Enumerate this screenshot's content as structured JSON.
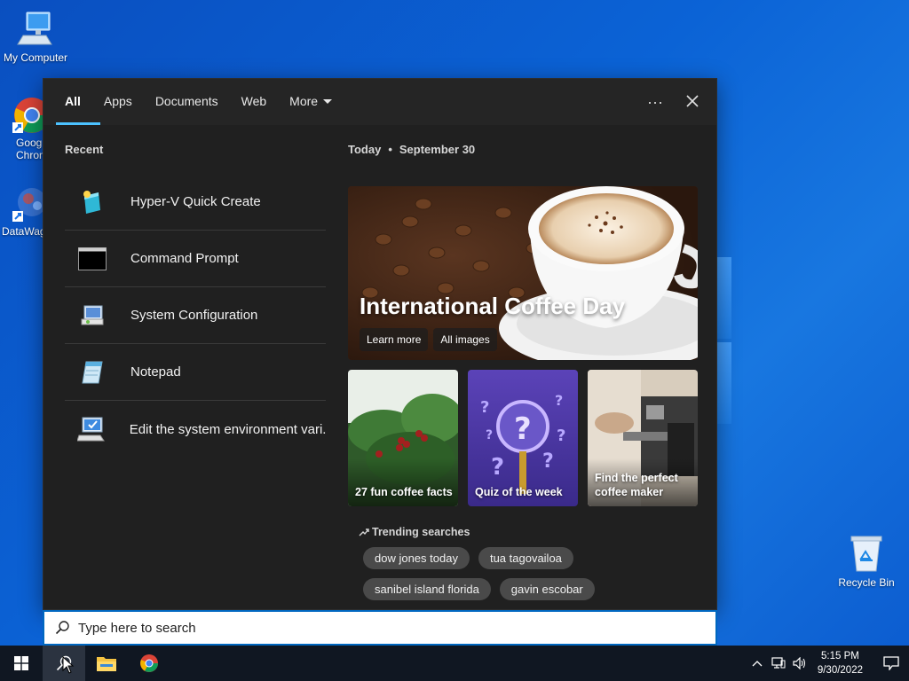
{
  "desktop": {
    "icons": [
      {
        "label": "My Computer",
        "icon": "computer-icon"
      },
      {
        "label": "Goog Chron",
        "icon": "chrome-icon"
      },
      {
        "label": "DataWag",
        "icon": "datawag-icon"
      },
      {
        "label": "Recycle Bin",
        "icon": "recycle-bin-icon"
      }
    ],
    "my_computer": "My Computer",
    "chrome_l1": "Goog",
    "chrome_l2": "Chron",
    "datawag": "DataWag",
    "recycle_bin": "Recycle Bin"
  },
  "search_panel": {
    "tabs": [
      {
        "label": "All"
      },
      {
        "label": "Apps"
      },
      {
        "label": "Documents"
      },
      {
        "label": "Web"
      },
      {
        "label": "More"
      }
    ],
    "more_options": "···",
    "close": "✕",
    "recent": {
      "title": "Recent",
      "items": [
        {
          "label": "Hyper-V Quick Create",
          "icon": "hyperv-icon"
        },
        {
          "label": "Command Prompt",
          "icon": "cmd-icon"
        },
        {
          "label": "System Configuration",
          "icon": "sysconfig-icon"
        },
        {
          "label": "Notepad",
          "icon": "notepad-icon"
        },
        {
          "label": "Edit the system environment vari...",
          "icon": "env-vars-icon"
        }
      ]
    },
    "today": {
      "label": "Today",
      "date": "September 30"
    },
    "hero": {
      "title": "International Coffee Day",
      "learn_more": "Learn more",
      "all_images": "All images"
    },
    "cards": [
      {
        "label": "27 fun coffee facts"
      },
      {
        "label": "Quiz of the week"
      },
      {
        "label": "Find the perfect coffee maker"
      }
    ],
    "trending": {
      "title": "Trending searches",
      "chips": [
        "dow jones today",
        "tua tagovailoa",
        "sanibel island florida",
        "gavin escobar"
      ]
    }
  },
  "searchbox": {
    "placeholder": "Type here to search"
  },
  "taskbar": {
    "time": "5:15 PM",
    "date": "9/30/2022"
  },
  "colors": {
    "accent": "#4cc2ff",
    "panel_bg": "#202020",
    "taskbar_bg": "#101722"
  }
}
